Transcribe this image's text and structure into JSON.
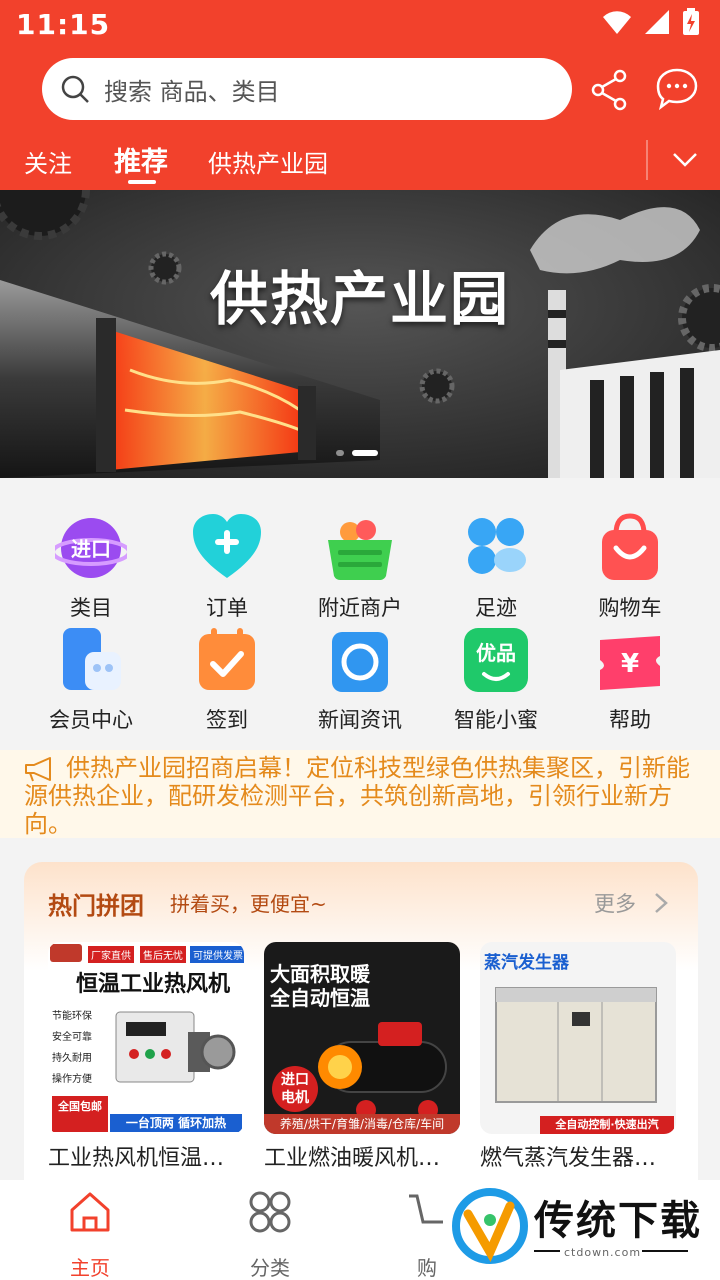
{
  "status_bar": {
    "time": "11:15"
  },
  "search": {
    "placeholder": "搜索 商品、类目"
  },
  "tabs": [
    {
      "label": "关注"
    },
    {
      "label": "推荐",
      "active": true
    },
    {
      "label": "供热产业园"
    }
  ],
  "banner": {
    "title": "供热产业园"
  },
  "quick_grid": [
    {
      "label": "类目",
      "icon": "import-badge-icon"
    },
    {
      "label": "订单",
      "icon": "heart-plus-icon"
    },
    {
      "label": "附近商户",
      "icon": "basket-icon"
    },
    {
      "label": "足迹",
      "icon": "dots-grid-icon"
    },
    {
      "label": "购物车",
      "icon": "shopping-bag-icon"
    },
    {
      "label": "会员中心",
      "icon": "phone-earbuds-icon"
    },
    {
      "label": "签到",
      "icon": "calendar-check-icon"
    },
    {
      "label": "新闻资讯",
      "icon": "camera-lens-icon"
    },
    {
      "label": "智能小蜜",
      "icon": "assistant-icon"
    },
    {
      "label": "帮助",
      "icon": "yen-ticket-icon"
    }
  ],
  "notice": {
    "text": "供热产业园招商启幕！定位科技型绿色供热集聚区，引新能源供热企业，配研发检测平台，共筑创新高地，引领行业新方向。"
  },
  "group_buy": {
    "title": "热门拼团",
    "subtitle": "拼着买，更便宜~",
    "more": "更多",
    "products": [
      {
        "name": "工业热风机恒温…",
        "img_title": "恒温工业热风机",
        "tags": [
          "厂家直供",
          "售后无忧",
          "可提供发票"
        ],
        "features": [
          "节能环保",
          "安全可靠",
          "持久耐用",
          "操作方便"
        ],
        "footer": [
          "全国包邮",
          "一台顶两 循环加热"
        ]
      },
      {
        "name": "工业燃油暖风机…",
        "img_title_1": "大面积取暖",
        "img_title_2": "全自动恒温",
        "badge": "进口 电机",
        "footer": "养殖/烘干/育雏/消毒/仓库/车间"
      },
      {
        "name": "燃气蒸汽发生器…",
        "img_title": "蒸汽发生器",
        "footer": "全自动控制·快速出汽"
      }
    ]
  },
  "bottom_nav": [
    {
      "label": "主页",
      "icon": "home-icon",
      "active": true
    },
    {
      "label": "分类",
      "icon": "category-icon"
    },
    {
      "label": "购",
      "icon": "cart-icon"
    }
  ],
  "watermark": {
    "text": "传统下载",
    "url": "ctdown.com"
  },
  "colors": {
    "brand": "#f2412c",
    "notice_text": "#e48a1c",
    "group_title": "#b34a12"
  }
}
